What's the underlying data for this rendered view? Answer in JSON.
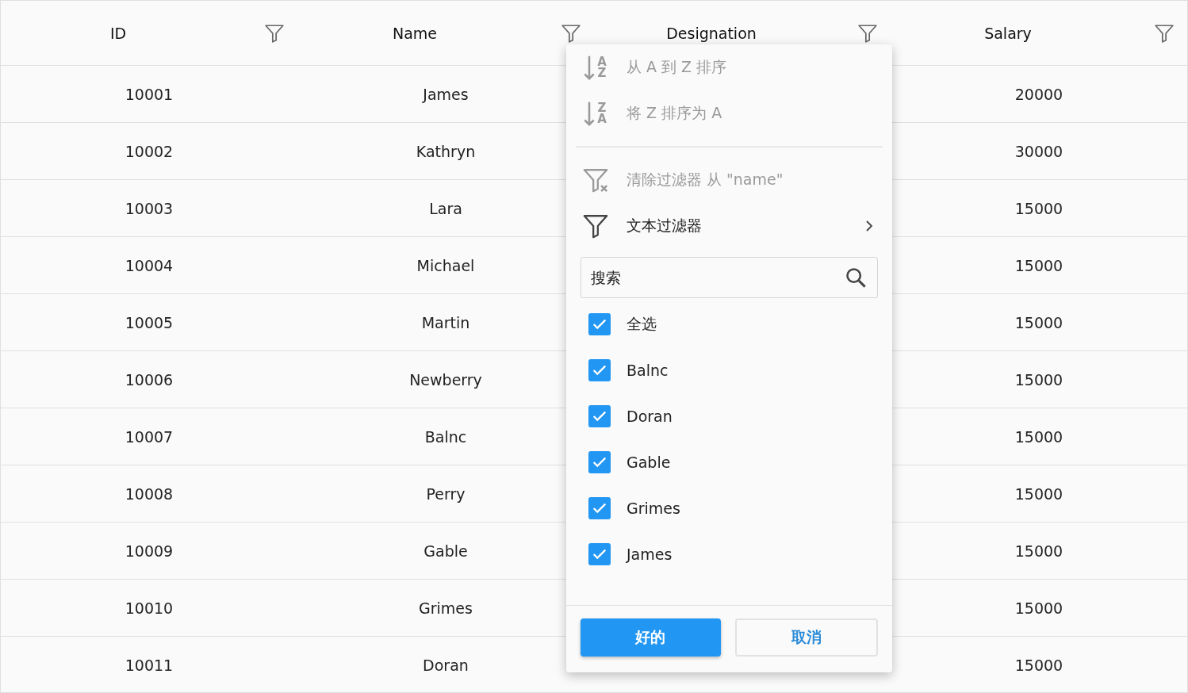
{
  "table": {
    "columns": [
      {
        "label": "ID"
      },
      {
        "label": "Name"
      },
      {
        "label": "Designation"
      },
      {
        "label": "Salary"
      }
    ],
    "rows": [
      {
        "id": "10001",
        "name": "James",
        "salary": "20000"
      },
      {
        "id": "10002",
        "name": "Kathryn",
        "salary": "30000"
      },
      {
        "id": "10003",
        "name": "Lara",
        "salary": "15000"
      },
      {
        "id": "10004",
        "name": "Michael",
        "salary": "15000"
      },
      {
        "id": "10005",
        "name": "Martin",
        "salary": "15000"
      },
      {
        "id": "10006",
        "name": "Newberry",
        "salary": "15000"
      },
      {
        "id": "10007",
        "name": "Balnc",
        "salary": "15000"
      },
      {
        "id": "10008",
        "name": "Perry",
        "salary": "15000"
      },
      {
        "id": "10009",
        "name": "Gable",
        "salary": "15000"
      },
      {
        "id": "10010",
        "name": "Grimes",
        "salary": "15000"
      },
      {
        "id": "10011",
        "name": "Doran",
        "salary": "15000"
      }
    ]
  },
  "filter_menu": {
    "menu_items": [
      {
        "kind": "sort-asc",
        "icon_letters": [
          "A",
          "Z"
        ],
        "label": "从 A 到 Z 排序",
        "disabled": true
      },
      {
        "kind": "sort-desc",
        "icon_letters": [
          "Z",
          "A"
        ],
        "label": "将 Z 排序为 A",
        "disabled": true
      },
      {
        "kind": "clear-filter",
        "label": "清除过滤器 从 \"name\"",
        "disabled": true
      },
      {
        "kind": "text-filter",
        "label": "文本过滤器",
        "disabled": false
      }
    ],
    "search": {
      "placeholder": "搜索"
    },
    "options": [
      {
        "label": "全选",
        "checked": true
      },
      {
        "label": "Balnc",
        "checked": true
      },
      {
        "label": "Doran",
        "checked": true
      },
      {
        "label": "Gable",
        "checked": true
      },
      {
        "label": "Grimes",
        "checked": true
      },
      {
        "label": "James",
        "checked": true
      }
    ],
    "buttons": [
      {
        "kind": "primary",
        "label": "好的"
      },
      {
        "kind": "secondary",
        "label": "取消"
      }
    ]
  }
}
